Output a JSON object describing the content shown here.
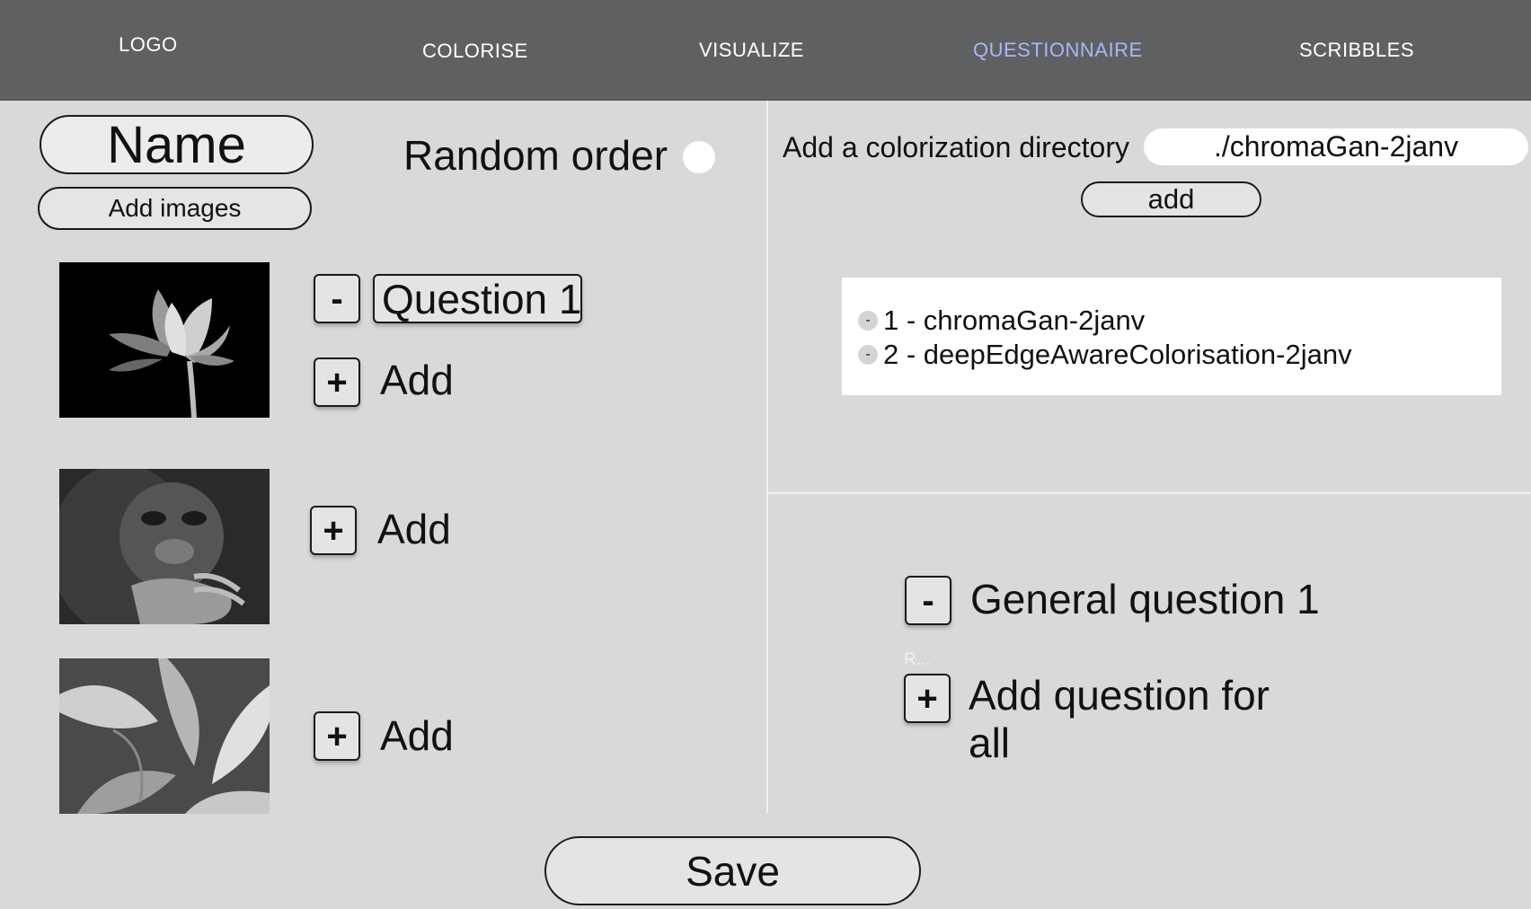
{
  "nav": {
    "logo": "LOGO",
    "items": [
      "COLORISE",
      "VISUALIZE",
      "QUESTIONNAIRE",
      "SCRIBBLES"
    ],
    "active": "QUESTIONNAIRE"
  },
  "left": {
    "name_field": "Name",
    "add_images": "Add images",
    "random_order": "Random order",
    "images": [
      {
        "description_icon": "lotus-image",
        "question": "Question 1",
        "add": "Add"
      },
      {
        "description_icon": "gorilla-image",
        "add": "Add"
      },
      {
        "description_icon": "leaves-image",
        "add": "Add"
      }
    ]
  },
  "right": {
    "dir_label": "Add a colorization directory",
    "dir_value": "./chromaGan-2janv",
    "add_button": "add",
    "directories": [
      "1 - chromaGan-2janv",
      "2 - deepEdgeAwareColorisation-2janv"
    ],
    "general_question": "General question 1",
    "faint_text": "R...",
    "add_question_for_all": "Add question for all"
  },
  "buttons": {
    "minus": "-",
    "plus": "+"
  },
  "save": "Save",
  "colors": {
    "nav_bg": "#5f6062",
    "active_nav": "#a9b6f5",
    "panel_bg": "#d9d9d9"
  }
}
